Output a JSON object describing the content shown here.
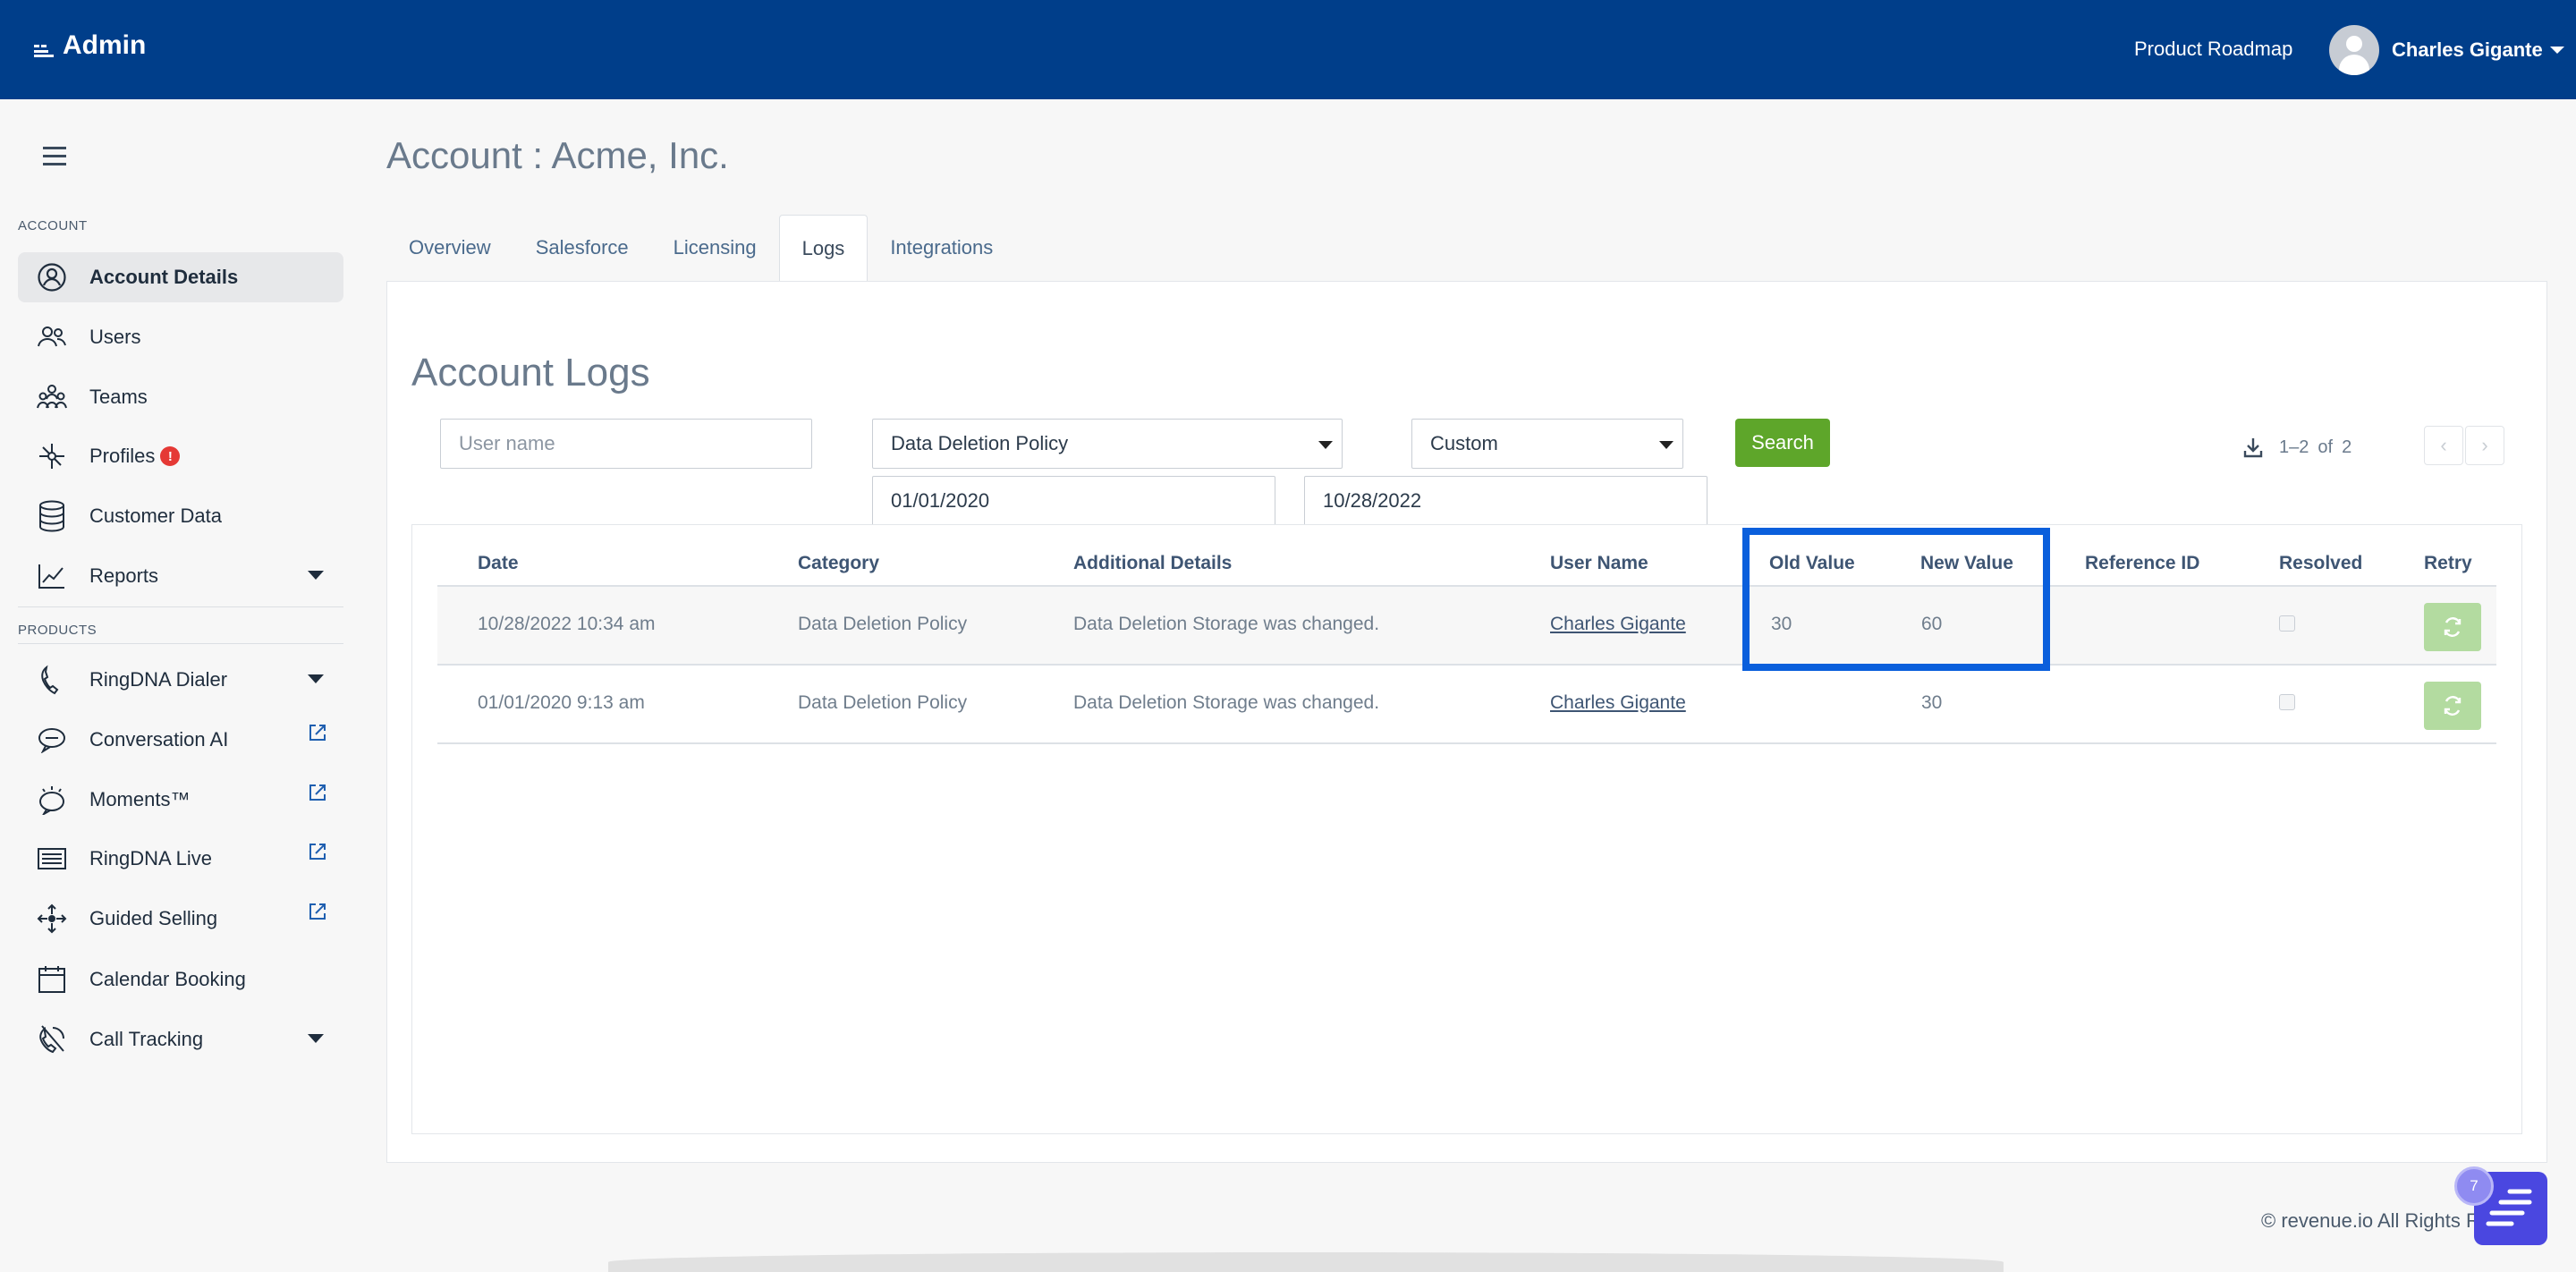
{
  "topbar": {
    "brand": "Admin",
    "roadmap_link": "Product Roadmap",
    "user_name": "Charles Gigante"
  },
  "sidebar": {
    "account_label": "ACCOUNT",
    "products_label": "PRODUCTS",
    "account_items": [
      {
        "label": "Account Details",
        "icon": "user-circle-icon",
        "active": true
      },
      {
        "label": "Users",
        "icon": "users-icon"
      },
      {
        "label": "Teams",
        "icon": "teams-icon"
      },
      {
        "label": "Profiles",
        "icon": "profiles-icon",
        "alert": "!"
      },
      {
        "label": "Customer Data",
        "icon": "database-icon"
      },
      {
        "label": "Reports",
        "icon": "chart-line-icon",
        "expandable": true
      }
    ],
    "product_items": [
      {
        "label": "RingDNA Dialer",
        "icon": "phone-icon",
        "expandable": true
      },
      {
        "label": "Conversation AI",
        "icon": "chat-bubble-icon",
        "external": true
      },
      {
        "label": "Moments™",
        "icon": "moments-icon",
        "external": true
      },
      {
        "label": "RingDNA Live",
        "icon": "live-icon",
        "external": true
      },
      {
        "label": "Guided Selling",
        "icon": "guided-selling-icon",
        "external": true
      },
      {
        "label": "Calendar Booking",
        "icon": "calendar-icon"
      },
      {
        "label": "Call Tracking",
        "icon": "call-tracking-icon",
        "expandable": true
      }
    ]
  },
  "page": {
    "title": "Account : Acme, Inc.",
    "tabs": [
      "Overview",
      "Salesforce",
      "Licensing",
      "Logs",
      "Integrations"
    ],
    "active_tab": "Logs"
  },
  "logs": {
    "title": "Account Logs",
    "filters": {
      "username_placeholder": "User name",
      "category_value": "Data Deletion Policy",
      "range_value": "Custom",
      "start_date": "01/01/2020",
      "end_date": "10/28/2022",
      "search_label": "Search"
    },
    "pager": {
      "range": "1–2",
      "of_label": "of",
      "total": "2"
    },
    "columns": [
      "Date",
      "Category",
      "Additional Details",
      "User Name",
      "Old Value",
      "New Value",
      "Reference ID",
      "Resolved",
      "Retry"
    ],
    "rows": [
      {
        "date": "10/28/2022 10:34 am",
        "category": "Data Deletion Policy",
        "details": "Data Deletion Storage was changed.",
        "user": "Charles Gigante",
        "old_value": "30",
        "new_value": "60",
        "reference_id": "",
        "resolved": false
      },
      {
        "date": "01/01/2020 9:13 am",
        "category": "Data Deletion Policy",
        "details": "Data Deletion Storage was changed.",
        "user": "Charles Gigante",
        "old_value": "",
        "new_value": "30",
        "reference_id": "",
        "resolved": false
      }
    ]
  },
  "footer": {
    "copyright": "© revenue.io All Rights R"
  },
  "chat": {
    "badge": "7"
  },
  "colors": {
    "topbar": "#003e8a",
    "search_button": "#5ea62a",
    "highlight": "#0a5fdc",
    "retry": "#b3dba0"
  }
}
